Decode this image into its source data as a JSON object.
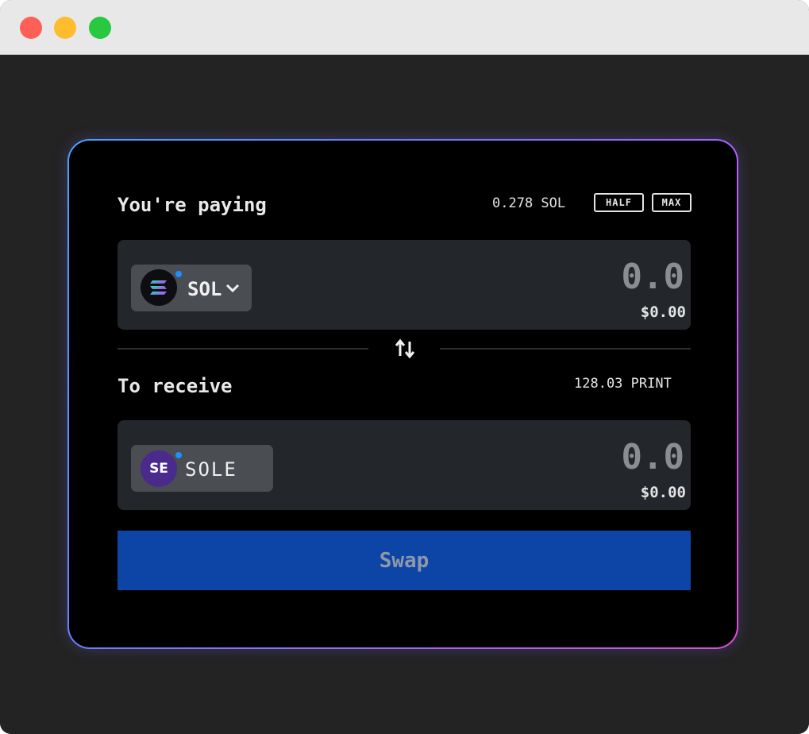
{
  "window": {
    "controls": [
      "close",
      "minimize",
      "maximize"
    ]
  },
  "colors": {
    "accent": "#0c45a5",
    "panel": "#23262b",
    "card": "#000000",
    "border_start": "#4aa3ff",
    "border_end": "#e24bd6"
  },
  "pay": {
    "label": "You're paying",
    "balance": "0.278 SOL",
    "half_label": "HALF",
    "max_label": "MAX",
    "token": {
      "symbol": "SOL",
      "icon": "solana-logo"
    },
    "amount_placeholder": "0.0",
    "usd_value": "$0.00"
  },
  "receive": {
    "label": "To receive",
    "balance": "128.03 PRINT",
    "token": {
      "symbol": "SOLE",
      "icon": "sole-logo",
      "logo_text": "SE"
    },
    "amount_placeholder": "0.0",
    "usd_value": "$0.00"
  },
  "swap_direction_icon": "↑↓",
  "swap_button_label": "Swap"
}
